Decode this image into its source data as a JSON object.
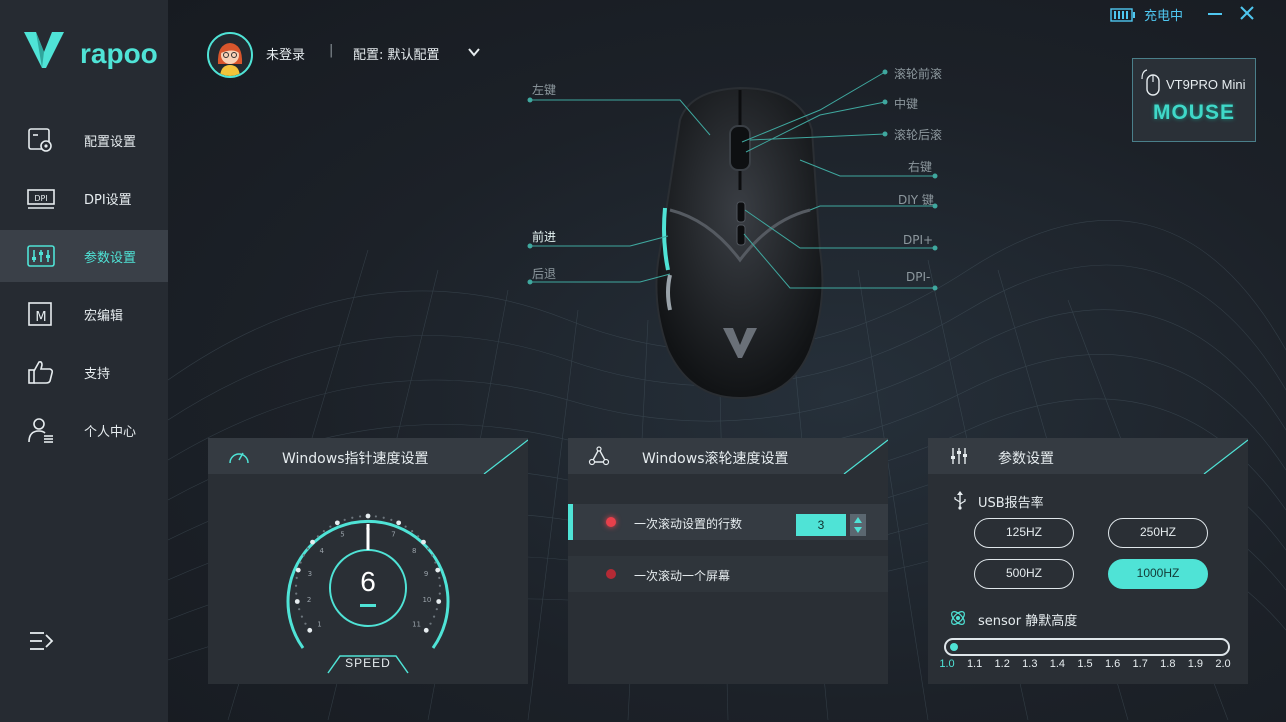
{
  "app": {
    "brand": "rapoo",
    "status": "充电中",
    "user": "未登录",
    "separator": "|",
    "config": "配置: 默认配置"
  },
  "sidebar": {
    "items": [
      {
        "label": "配置设置",
        "icon": "config-settings-icon"
      },
      {
        "label": "DPI设置",
        "icon": "dpi-icon"
      },
      {
        "label": "参数设置",
        "icon": "equalizer-icon",
        "active": true
      },
      {
        "label": "宏编辑",
        "icon": "macro-icon"
      },
      {
        "label": "支持",
        "icon": "thumbs-up-icon"
      },
      {
        "label": "个人中心",
        "icon": "user-center-icon"
      }
    ]
  },
  "device": {
    "name": "VT9PRO Mini",
    "type": "MOUSE"
  },
  "callouts": {
    "left": [
      "左键",
      "前进",
      "后退"
    ],
    "right": [
      "滚轮前滚",
      "中键",
      "滚轮后滚",
      "右键",
      "DIY 键",
      "DPI+",
      "DPI-"
    ]
  },
  "pointer_panel": {
    "title": "Windows指针速度设置",
    "value": "6",
    "speed_label": "SPEED",
    "scale": [
      "1",
      "2",
      "3",
      "4",
      "5",
      "6",
      "7",
      "8",
      "9",
      "10",
      "11"
    ]
  },
  "scroll_panel": {
    "title": "Windows滚轮速度设置",
    "rows": [
      {
        "label": "一次滚动设置的行数",
        "value": "3",
        "active": true
      },
      {
        "label": "一次滚动一个屏幕",
        "active": false
      }
    ]
  },
  "params_panel": {
    "title": "参数设置",
    "usb_label": "USB报告率",
    "rates": [
      "125HZ",
      "250HZ",
      "500HZ",
      "1000HZ"
    ],
    "selected_rate": "1000HZ",
    "sensor_label": "sensor 静默高度",
    "sensor_ticks": [
      "1.0",
      "1.1",
      "1.2",
      "1.3",
      "1.4",
      "1.5",
      "1.6",
      "1.7",
      "1.8",
      "1.9",
      "2.0"
    ],
    "sensor_value": 1.0
  },
  "colors": {
    "accent": "#4fe3d6",
    "charge": "#4fc7f0",
    "alert": "#e8404b"
  }
}
